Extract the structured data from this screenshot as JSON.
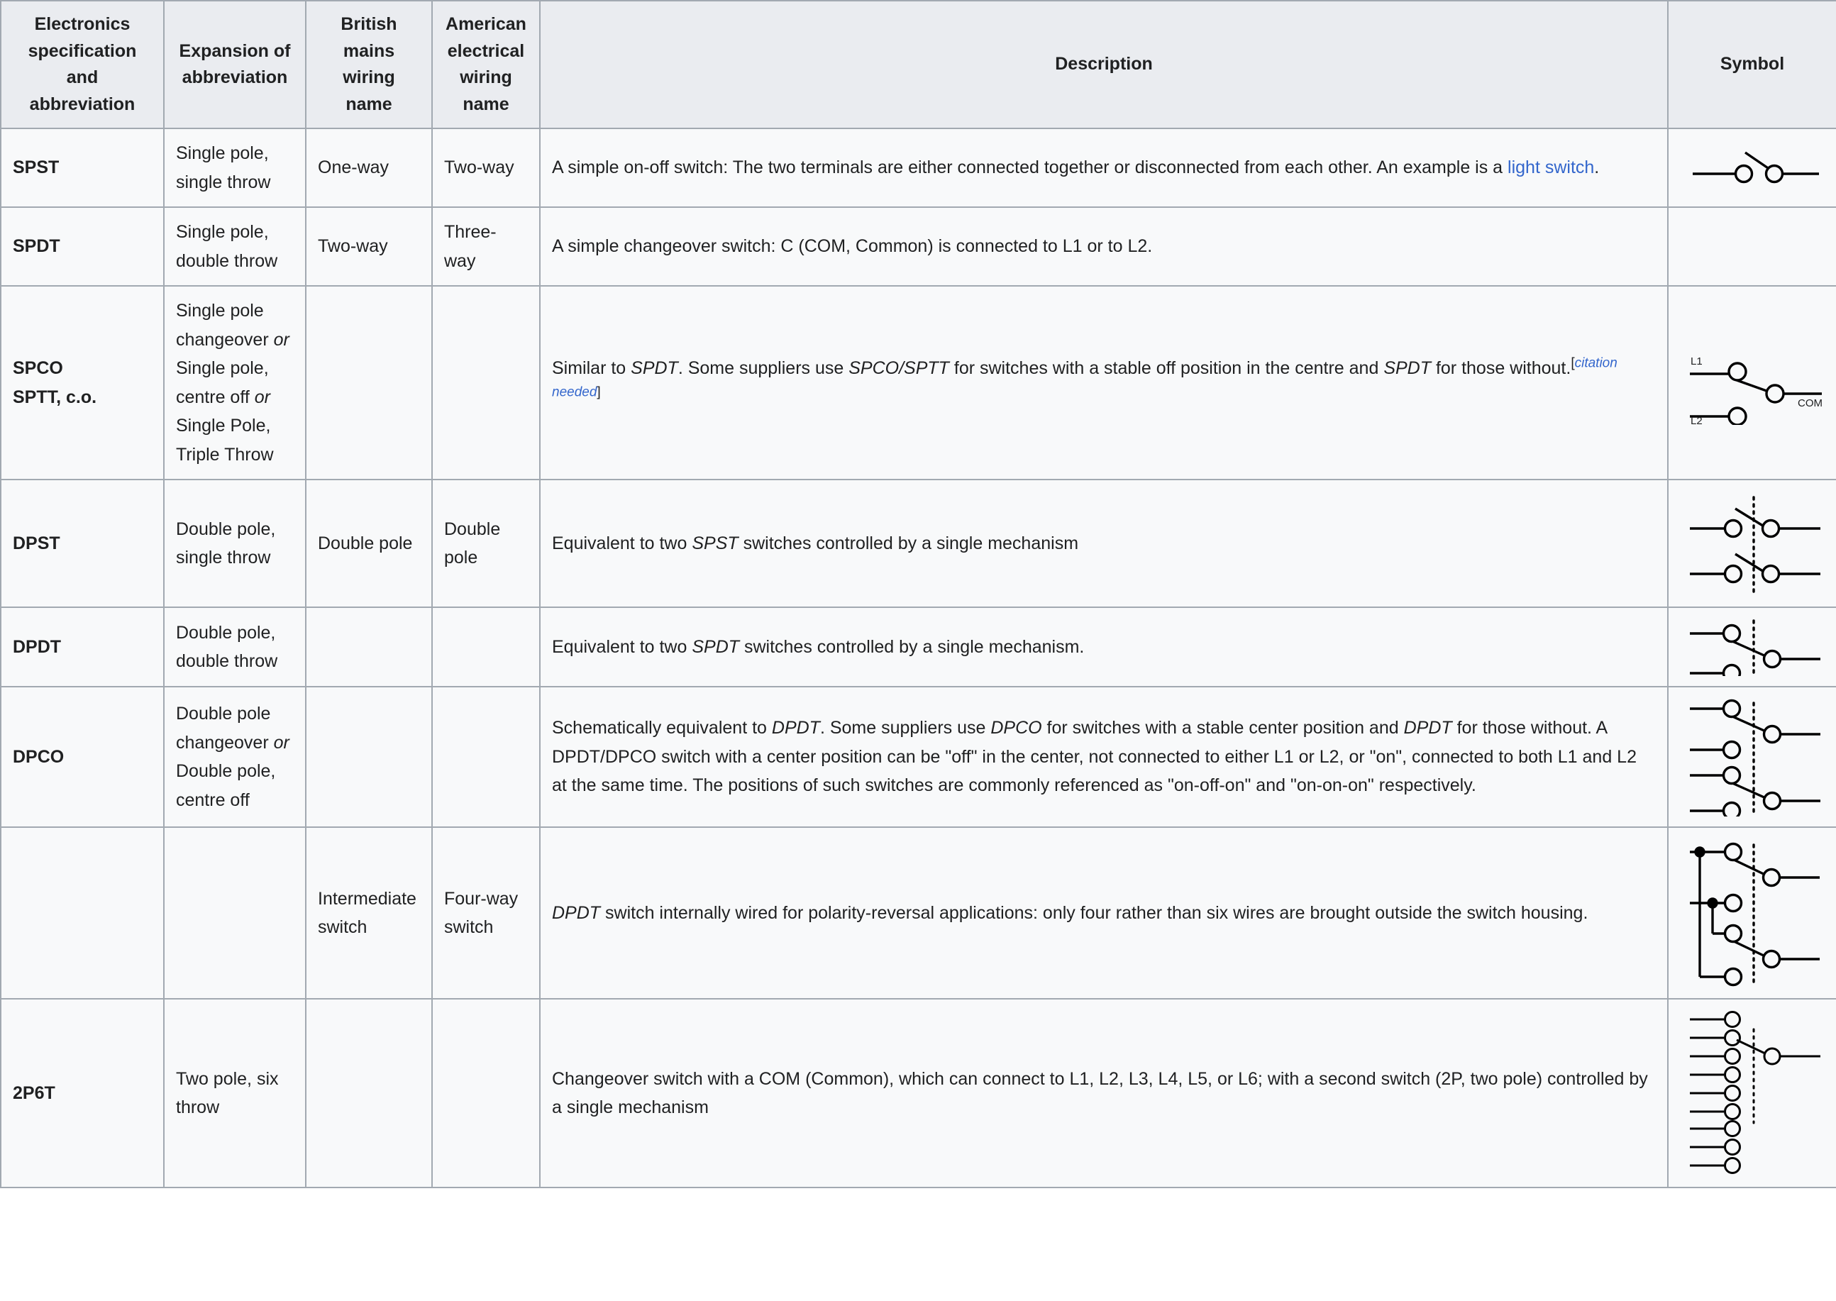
{
  "table": {
    "headers": [
      "Electronics specification and abbreviation",
      "Expansion of abbreviation",
      "British mains wiring name",
      "American electrical wiring name",
      "Description",
      "Symbol"
    ],
    "rows": [
      {
        "abbreviation": "SPST",
        "expansion": "Single pole, single throw",
        "british": "One-way",
        "american": "Two-way",
        "description_pre": "A simple on-off switch: The two terminals are either connected together or disconnected from each other. An example is a ",
        "description_link": "light switch",
        "description_post": ".",
        "symbol": "spst-symbol"
      },
      {
        "abbreviation": "SPDT",
        "expansion": "Single pole, double throw",
        "british": "Two-way",
        "american": "Three-way",
        "description": "A simple changeover switch: C (COM, Common) is connected to L1 or to L2.",
        "symbol": "none"
      },
      {
        "abbreviation_line1": "SPCO",
        "abbreviation_line2": "SPTT, c.o.",
        "expansion_part1": "Single pole changeover ",
        "expansion_or1": "or",
        "expansion_part2": " Single pole, centre off ",
        "expansion_or2": "or",
        "expansion_part3": " Single Pole, Triple Throw",
        "british": "",
        "american": "",
        "desc_t1": "Similar to ",
        "desc_i1": "SPDT",
        "desc_t2": ". Some suppliers use ",
        "desc_i2": "SPCO/SPTT",
        "desc_t3": " for switches with a stable off position in the centre and ",
        "desc_i3": "SPDT",
        "desc_t4": " for those without.",
        "citation": "citation needed",
        "symbol": "spco-symbol",
        "symbol_labels": {
          "l1": "L1",
          "l2": "L2",
          "com": "COM"
        }
      },
      {
        "abbreviation": "DPST",
        "expansion": "Double pole, single throw",
        "british": "Double pole",
        "american": "Double pole",
        "desc_t1": "Equivalent to two ",
        "desc_i1": "SPST",
        "desc_t2": " switches controlled by a single mechanism",
        "symbol": "dpst-symbol"
      },
      {
        "abbreviation": "DPDT",
        "expansion": "Double pole, double throw",
        "british": "",
        "american": "",
        "desc_t1": "Equivalent to two ",
        "desc_i1": "SPDT",
        "desc_t2": " switches controlled by a single mechanism.",
        "symbol": "dpdt-symbol"
      },
      {
        "abbreviation": "DPCO",
        "expansion_part1": "Double pole changeover ",
        "expansion_or1": "or",
        "expansion_part2": " Double pole, centre off",
        "british": "",
        "american": "",
        "desc_t1": "Schematically equivalent to ",
        "desc_i1": "DPDT",
        "desc_t2": ". Some suppliers use ",
        "desc_i2": "DPCO",
        "desc_t3": " for switches with a stable center position and ",
        "desc_i3": "DPDT",
        "desc_t4": " for those without. A DPDT/DPCO switch with a center position can be \"off\" in the center, not connected to either L1 or L2, or \"on\", connected to both L1 and L2 at the same time. The positions of such switches are commonly referenced as \"on-off-on\" and \"on-on-on\" respectively.",
        "symbol": "dpco-symbol"
      },
      {
        "abbreviation": "",
        "expansion": "",
        "british": "Intermediate switch",
        "american": "Four-way switch",
        "desc_i1": "DPDT",
        "desc_t2": " switch internally wired for polarity-reversal applications: only four rather than six wires are brought outside the switch housing.",
        "symbol": "intermediate-symbol"
      },
      {
        "abbreviation": "2P6T",
        "expansion": "Two pole, six throw",
        "british": "",
        "american": "",
        "description": "Changeover switch with a COM (Common), which can connect to L1, L2, L3, L4, L5, or L6; with a second switch (2P, two pole) controlled by a single mechanism",
        "symbol": "2p6t-symbol"
      }
    ]
  },
  "colors": {
    "link": "#3366cc",
    "header_bg": "#eaecf0",
    "cell_bg": "#f8f9fa",
    "border": "#a2a9b1",
    "text": "#202122"
  }
}
